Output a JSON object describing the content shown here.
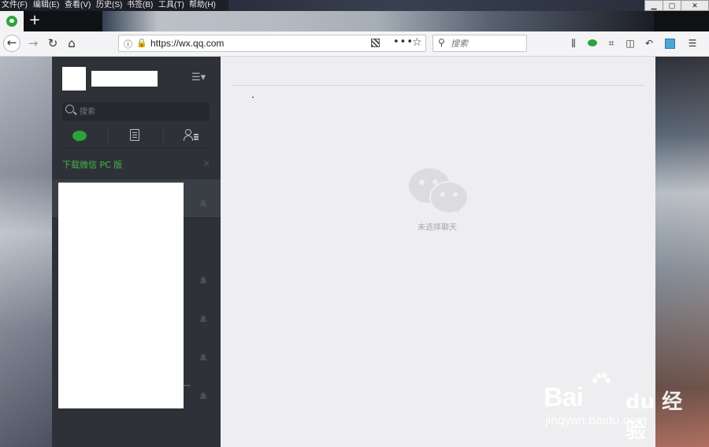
{
  "menubar": {
    "items": [
      "文件(F)",
      "编辑(E)",
      "查看(V)",
      "历史(S)",
      "书签(B)",
      "工具(T)",
      "帮助(H)"
    ]
  },
  "window_controls": {
    "minimize": "▁",
    "maximize": "▢",
    "close": "✕"
  },
  "tabs": {
    "new_tab": "+"
  },
  "navbar": {
    "url": "https://wx.qq.com",
    "search_placeholder": "搜索"
  },
  "wechat": {
    "search_placeholder": "搜索",
    "download_link": "下载微信 PC 版",
    "download_close": "✕",
    "empty_text": "未选择聊天",
    "accent": "#2ca43a",
    "sidebar_bg": "#2e3238",
    "main_bg": "#eeedf0"
  },
  "icons": [
    "wechat-favicon",
    "back-arrow-icon",
    "forward-arrow-icon",
    "reload-icon",
    "home-icon",
    "info-icon",
    "lock-icon",
    "qr-code-icon",
    "more-icon",
    "star-icon",
    "search-icon",
    "library-icon",
    "wechat-ext-icon",
    "crop-icon",
    "sidebar-icon",
    "undo-icon",
    "extension-icon",
    "hamburger-menu-icon",
    "chat-icon",
    "articles-icon",
    "contacts-icon",
    "mute-icon"
  ],
  "watermark": {
    "brand": "Bai",
    "brand2": "du 经验",
    "domain": "jingyan.baidu.com"
  }
}
